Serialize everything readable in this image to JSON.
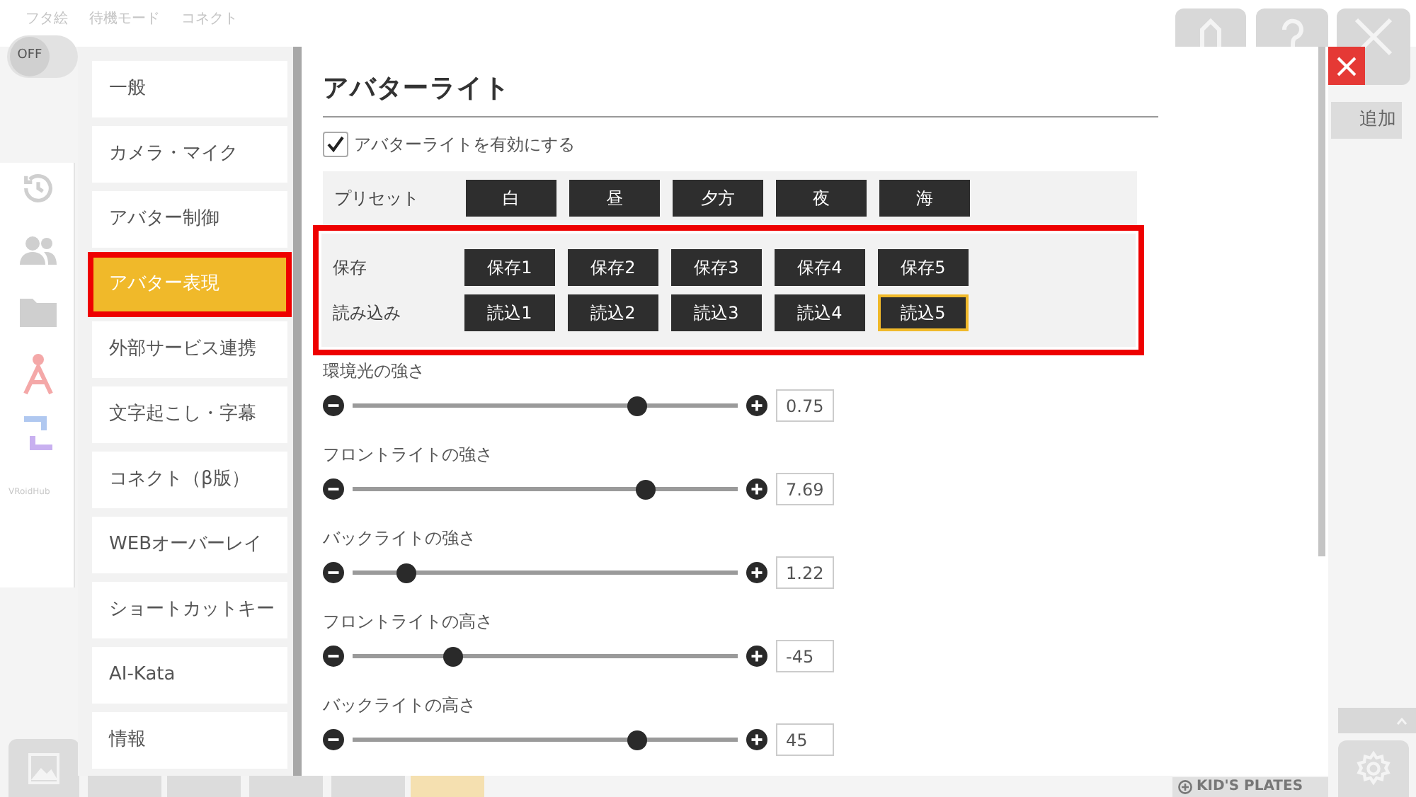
{
  "background": {
    "tabs": [
      {
        "label": "フタ絵"
      },
      {
        "label": "待機モード"
      },
      {
        "label": "コネクト"
      }
    ],
    "toggle": {
      "label": "OFF",
      "on": false
    },
    "side_label": "VRoidHub",
    "add_button": "追加",
    "kids_plates": "KID'S PLATES"
  },
  "settings_menu": [
    {
      "label": "一般",
      "selected": false
    },
    {
      "label": "カメラ・マイク",
      "selected": false
    },
    {
      "label": "アバター制御",
      "selected": false
    },
    {
      "label": "アバター表現",
      "selected": true
    },
    {
      "label": "外部サービス連携",
      "selected": false
    },
    {
      "label": "文字起こし・字幕",
      "selected": false
    },
    {
      "label": "コネクト（β版）",
      "selected": false
    },
    {
      "label": "WEBオーバーレイ",
      "selected": false
    },
    {
      "label": "ショートカットキー",
      "selected": false
    },
    {
      "label": "AI-Kata",
      "selected": false
    },
    {
      "label": "情報",
      "selected": false
    }
  ],
  "panel": {
    "title": "アバターライト",
    "enable": {
      "label": "アバターライトを有効にする",
      "checked": true
    },
    "preset": {
      "label": "プリセット",
      "buttons": [
        {
          "label": "白",
          "selected": false
        },
        {
          "label": "昼",
          "selected": false
        },
        {
          "label": "夕方",
          "selected": false
        },
        {
          "label": "夜",
          "selected": false
        },
        {
          "label": "海",
          "selected": false
        }
      ]
    },
    "save": {
      "label": "保存",
      "buttons": [
        {
          "label": "保存1",
          "selected": false
        },
        {
          "label": "保存2",
          "selected": false
        },
        {
          "label": "保存3",
          "selected": false
        },
        {
          "label": "保存4",
          "selected": false
        },
        {
          "label": "保存5",
          "selected": false
        }
      ]
    },
    "load": {
      "label": "読み込み",
      "buttons": [
        {
          "label": "読込1",
          "selected": false
        },
        {
          "label": "読込2",
          "selected": false
        },
        {
          "label": "読込3",
          "selected": false
        },
        {
          "label": "読込4",
          "selected": false
        },
        {
          "label": "読込5",
          "selected": true
        }
      ]
    },
    "sliders": [
      {
        "label": "環境光の強さ",
        "level": 0.74,
        "reading": "0.75"
      },
      {
        "label": "フロントライトの強さ",
        "level": 0.76,
        "reading": "7.69"
      },
      {
        "label": "バックライトの強さ",
        "level": 0.14,
        "reading": "1.22"
      },
      {
        "label": "フロントライトの高さ",
        "level": 0.26,
        "reading": "-45"
      },
      {
        "label": "バックライトの高さ",
        "level": 0.74,
        "reading": "45"
      }
    ]
  }
}
